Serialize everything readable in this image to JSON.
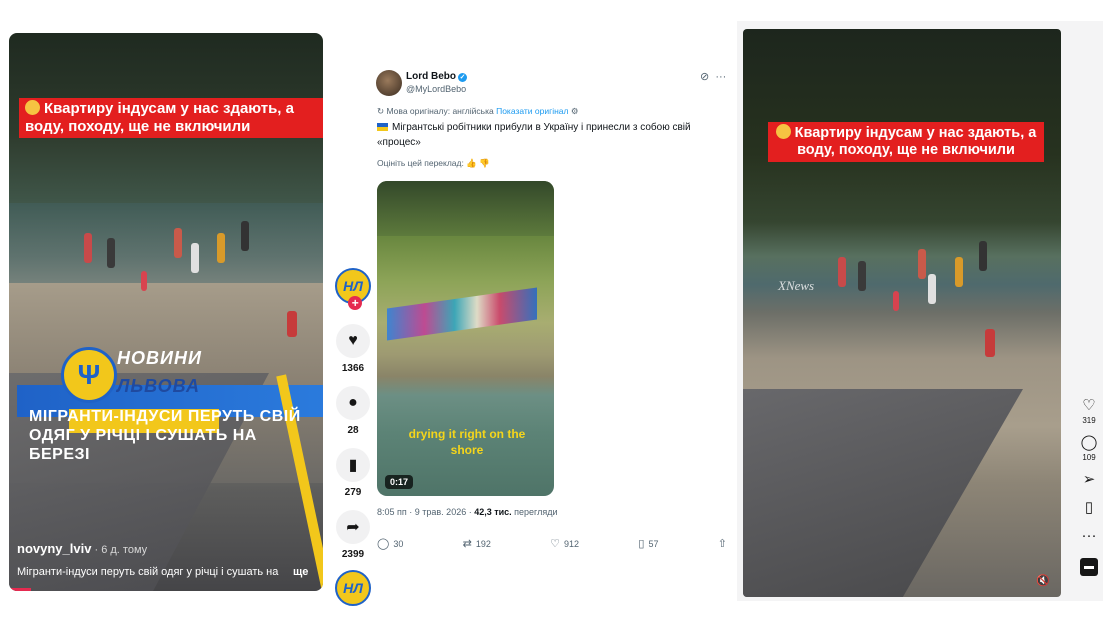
{
  "left": {
    "banner": "Квартиру індусам у нас здають, а воду, походу, ще не включили",
    "news_line1": "НОВИНИ",
    "news_line2": "ЛЬВОВА",
    "news_title": "МІГРАНТИ-ІНДУСИ ПЕРУТЬ СВІЙ ОДЯГ У РІЧЦІ І СУШАТЬ НА БЕРЕЗІ",
    "author": "novyny_lviv",
    "time": " · 6 д. тому",
    "caption": "Мігранти-індуси перуть свій одяг у річці і сушать на",
    "more": "ще",
    "rail": {
      "logo_text": "НЛ",
      "likes": "1366",
      "comments": "28",
      "saves": "279",
      "shares": "2399"
    }
  },
  "mid": {
    "name": "Lord Bebo",
    "handle": "@MyLordBebo",
    "translated_from": "Мова оригіналу: англійська",
    "show_original": "Показати оригінал",
    "text": "Мігрантські робітники прибули в Україну і принесли з собою свій «процес»",
    "rate": "Оцініть цей переклад:",
    "video_caption": "drying it right on the shore",
    "duration": "0:17",
    "datetime": "8:05 пп · 9 трав. 2026 · ",
    "views_count": "42,3 тис.",
    "views_label": " перегляди",
    "actions": {
      "replies": "30",
      "reposts": "192",
      "likes": "912",
      "bookmarks": "57"
    }
  },
  "right": {
    "banner": "Квартиру індусам у нас здають, а воду, походу, ще не включили",
    "watermark": "XNews",
    "likes": "319",
    "comments": "109"
  },
  "colors": {
    "banner_red": "#e31f1f",
    "news_blue": "#1f62c7",
    "news_yellow": "#f2c71b",
    "x_link": "#1d9bf0"
  }
}
